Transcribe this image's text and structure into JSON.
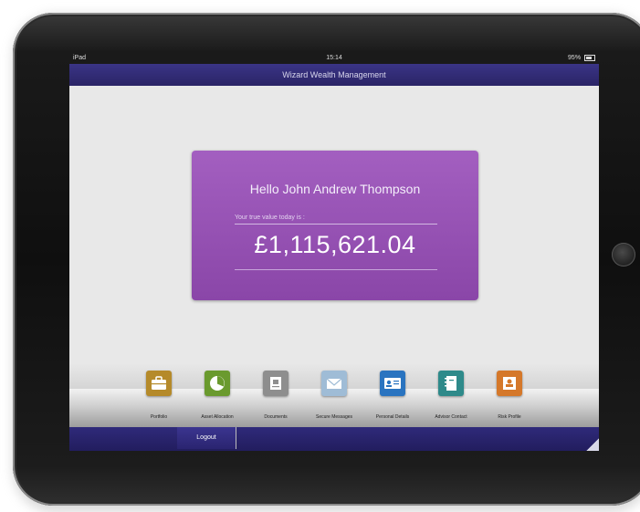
{
  "status_bar": {
    "carrier": "iPad",
    "time": "15:14",
    "battery": "95%"
  },
  "app": {
    "title": "Wizard Wealth Management"
  },
  "welcome_card": {
    "greeting": "Hello John Andrew Thompson",
    "value_label": "Your true value today is :",
    "value_amount": "£1,115,621.04"
  },
  "dock": {
    "items": [
      {
        "label": "Portfolio",
        "icon": "briefcase-icon",
        "color": "#b58a2a"
      },
      {
        "label": "Asset Allocation",
        "icon": "pie-chart-icon",
        "color": "#6a9a2e"
      },
      {
        "label": "Documents",
        "icon": "document-icon",
        "color": "#8e8e8e"
      },
      {
        "label": "Secure Messages",
        "icon": "envelope-icon",
        "color": "#9fbcd6"
      },
      {
        "label": "Personal Details",
        "icon": "contact-card-icon",
        "color": "#2a74c0"
      },
      {
        "label": "Advisor Contact",
        "icon": "address-book-icon",
        "color": "#2e8a8a"
      },
      {
        "label": "Risk Profile",
        "icon": "profile-chart-icon",
        "color": "#d5782a"
      }
    ]
  },
  "footer": {
    "logout_label": "Logout"
  },
  "colors": {
    "brand_navy": "#2a2466",
    "card_purple": "#9a52b8"
  }
}
